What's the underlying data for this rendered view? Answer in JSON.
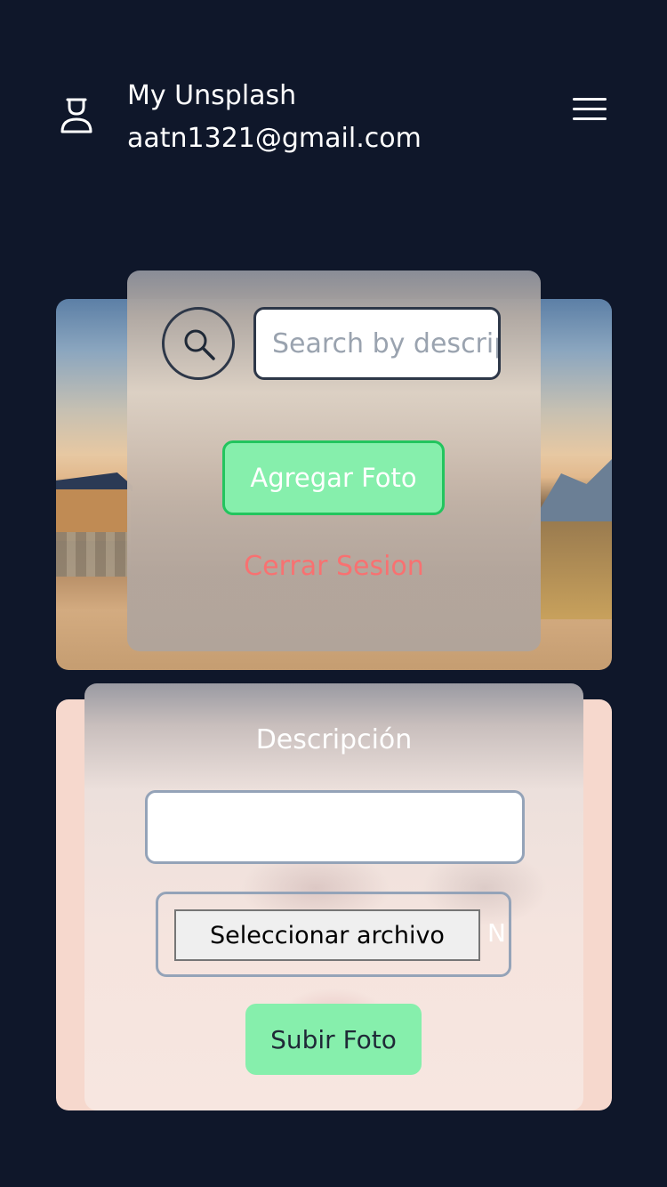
{
  "header": {
    "app_name": "My Unsplash",
    "email": "aatn1321@gmail.com",
    "user_icon": "user-icon",
    "menu_icon": "hamburger-menu-icon"
  },
  "toolbar": {
    "search_icon": "search-icon",
    "search_placeholder": "Search by description",
    "add_photo_label": "Agregar Foto",
    "logout_label": "Cerrar Sesion"
  },
  "upload_form": {
    "description_label": "Descripción",
    "description_value": "",
    "file_button_label": "Seleccionar archivo",
    "file_status_text": "N",
    "submit_label": "Subir Foto"
  },
  "colors": {
    "background": "#0f172a",
    "accent_green": "#86efac",
    "accent_green_border": "#22c55e",
    "danger_text": "#f87171",
    "upload_card": "#f6d8cd"
  }
}
